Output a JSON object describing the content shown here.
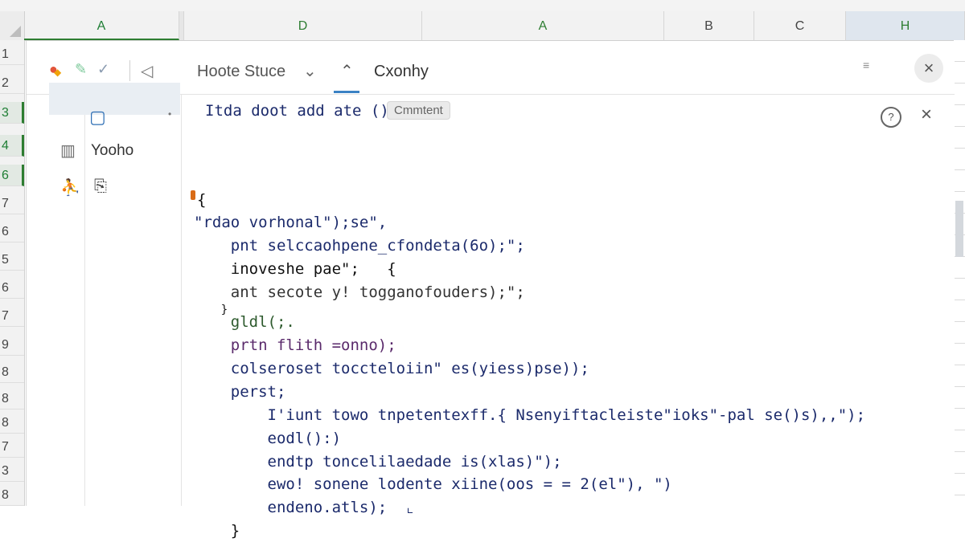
{
  "spreadsheet": {
    "columns": [
      "A",
      "D",
      "A",
      "B",
      "C",
      "H"
    ],
    "rows": [
      "1",
      "2",
      "3",
      "4",
      "6",
      "7",
      "6",
      "5",
      "6",
      "7",
      "9",
      "8",
      "8",
      "8",
      "7",
      "3",
      "8"
    ]
  },
  "toolbar": {
    "route_label": "Hoote Stuce",
    "tab_label": "Cxonhy",
    "close_glyph": "×"
  },
  "sidebar": {
    "item_label": "Yooho"
  },
  "editor": {
    "header": "Itda doot add ate ()\"",
    "badge": "Cmmtent",
    "help_glyph": "?",
    "close_glyph": "×",
    "lines": [
      "{",
      "\"rdao vorhonal\");se\",",
      "    pnt selccaohpene_cfondeta(6o);\";",
      "    inoveshe pae\";   {",
      "    ant secote y! togganofouders);\";",
      "    }",
      "    gldl(;.",
      "    prtn flith =onno);",
      "    colseroset toccteloiin\" es(yiess)pse));",
      "    perst;",
      "        I'iunt towo tnpetentexff.{ Nsenyiftacleiste\"ioks\"-pal se()s),,\");",
      "        eodl():)",
      "        endtp toncelilaedade is(xlas)\");",
      "        ewo! sonene lodente xiine(oos = = 2(el\"), \")",
      "        endeno.atls);  ⌞",
      "    }"
    ]
  },
  "colors": {
    "accent_green": "#2e7d32",
    "accent_blue": "#3b82c4",
    "marker_orange": "#d96b16",
    "code_navy": "#1b2a6b"
  }
}
